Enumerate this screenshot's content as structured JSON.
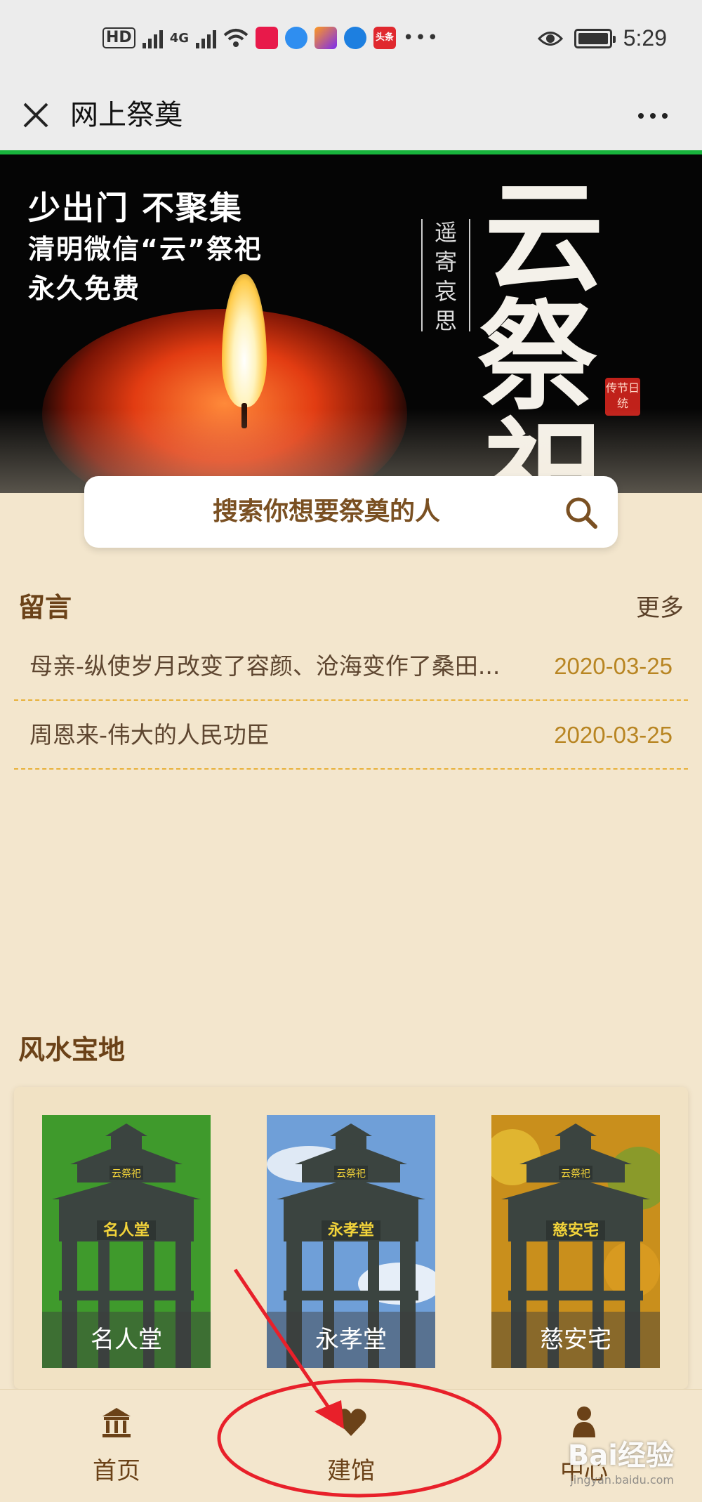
{
  "status_bar": {
    "hd": "HD",
    "network": "4G",
    "news_app": "头条",
    "time": "5:29"
  },
  "title_bar": {
    "title": "网上祭奠"
  },
  "banner": {
    "slogan_1": "少出门 不聚集",
    "slogan_2": "清明微信“云”祭祀",
    "slogan_3": "永久免费",
    "vertical_text": "遥寄哀思",
    "big_chars": [
      "云",
      "祭",
      "祀"
    ],
    "seal_text": "传节日统"
  },
  "search": {
    "placeholder": "搜索你想要祭奠的人"
  },
  "messages": {
    "title": "留言",
    "more": "更多",
    "items": [
      {
        "title": "母亲-纵使岁月改变了容颜、沧海变作了桑田...",
        "date": "2020-03-25"
      },
      {
        "title": "周恩来-伟大的人民功臣",
        "date": "2020-03-25"
      }
    ]
  },
  "halls": {
    "title": "风水宝地",
    "items": [
      {
        "label": "名人堂",
        "plaque": "名人堂",
        "top_plaque": "云祭祀",
        "bg": "#3f9a2c"
      },
      {
        "label": "永孝堂",
        "plaque": "永孝堂",
        "top_plaque": "云祭祀",
        "bg": "#6f9fd8"
      },
      {
        "label": "慈安宅",
        "plaque": "慈安宅",
        "top_plaque": "云祭祀",
        "bg": "#c98f1c"
      }
    ]
  },
  "bottom_nav": {
    "items": [
      {
        "label": "首页",
        "icon": "temple-icon"
      },
      {
        "label": "建馆",
        "icon": "heart-icon"
      },
      {
        "label": "中心",
        "icon": "user-icon"
      }
    ]
  },
  "watermark": {
    "text": "Bai经验",
    "url": "jingyan.baidu.com"
  },
  "colors": {
    "accent_brown": "#6b4218",
    "date_gold": "#b88522",
    "page_bg": "#f3e6cd",
    "progress_green": "#18b33c",
    "annotation_red": "#e8202a"
  }
}
